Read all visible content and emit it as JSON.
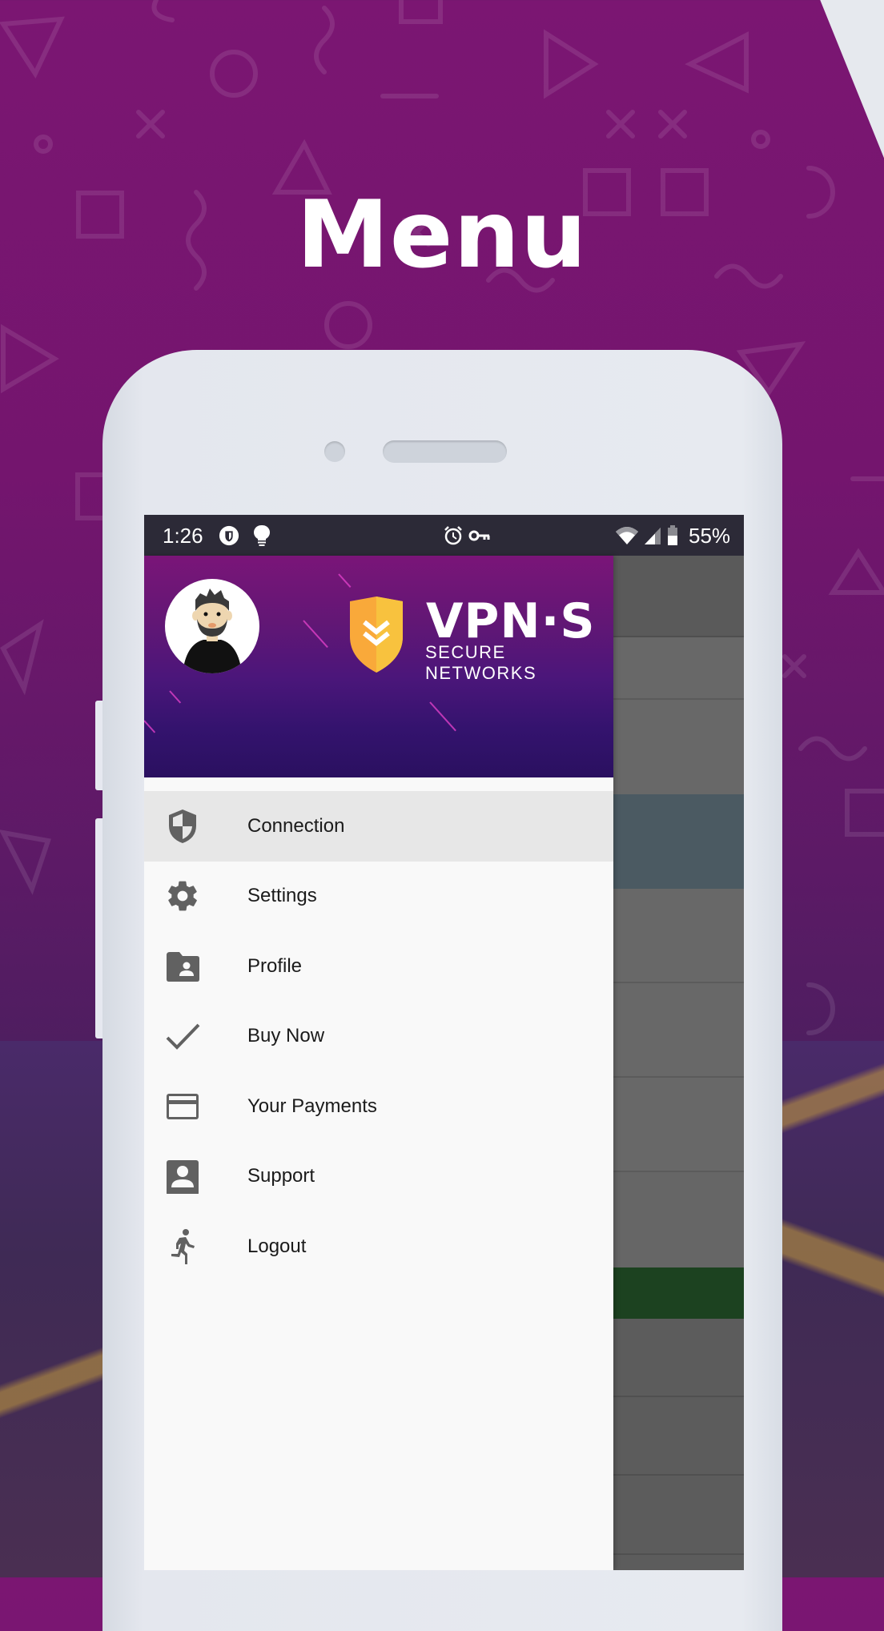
{
  "page": {
    "title": "Menu"
  },
  "status_bar": {
    "time": "1:26",
    "left_icons": [
      "shield-circle-icon",
      "lightbulb-icon"
    ],
    "right_icons": [
      "alarm-icon",
      "vpn-key-icon",
      "wifi-icon",
      "cell-signal-icon",
      "battery-icon"
    ],
    "battery_percent": "55%"
  },
  "drawer": {
    "header": {
      "brand_name": "VPN·S",
      "brand_tagline": "SECURE NETWORKS",
      "colors": {
        "shield": "#f7b733",
        "gradient_top": "#7a1578",
        "gradient_bottom": "#2a1060"
      }
    },
    "items": [
      {
        "label": "Connection",
        "icon": "shield-icon",
        "active": true
      },
      {
        "label": "Settings",
        "icon": "gear-icon",
        "active": false
      },
      {
        "label": "Profile",
        "icon": "folder-account-icon",
        "active": false
      },
      {
        "label": "Buy Now",
        "icon": "check-icon",
        "active": false
      },
      {
        "label": "Your Payments",
        "icon": "credit-card-icon",
        "active": false
      },
      {
        "label": "Support",
        "icon": "account-box-icon",
        "active": false
      },
      {
        "label": "Logout",
        "icon": "running-person-icon",
        "active": false
      }
    ]
  },
  "background_app": {
    "accent_rows": {
      "selected": "#4b5a62",
      "connected": "#1c4220"
    }
  }
}
